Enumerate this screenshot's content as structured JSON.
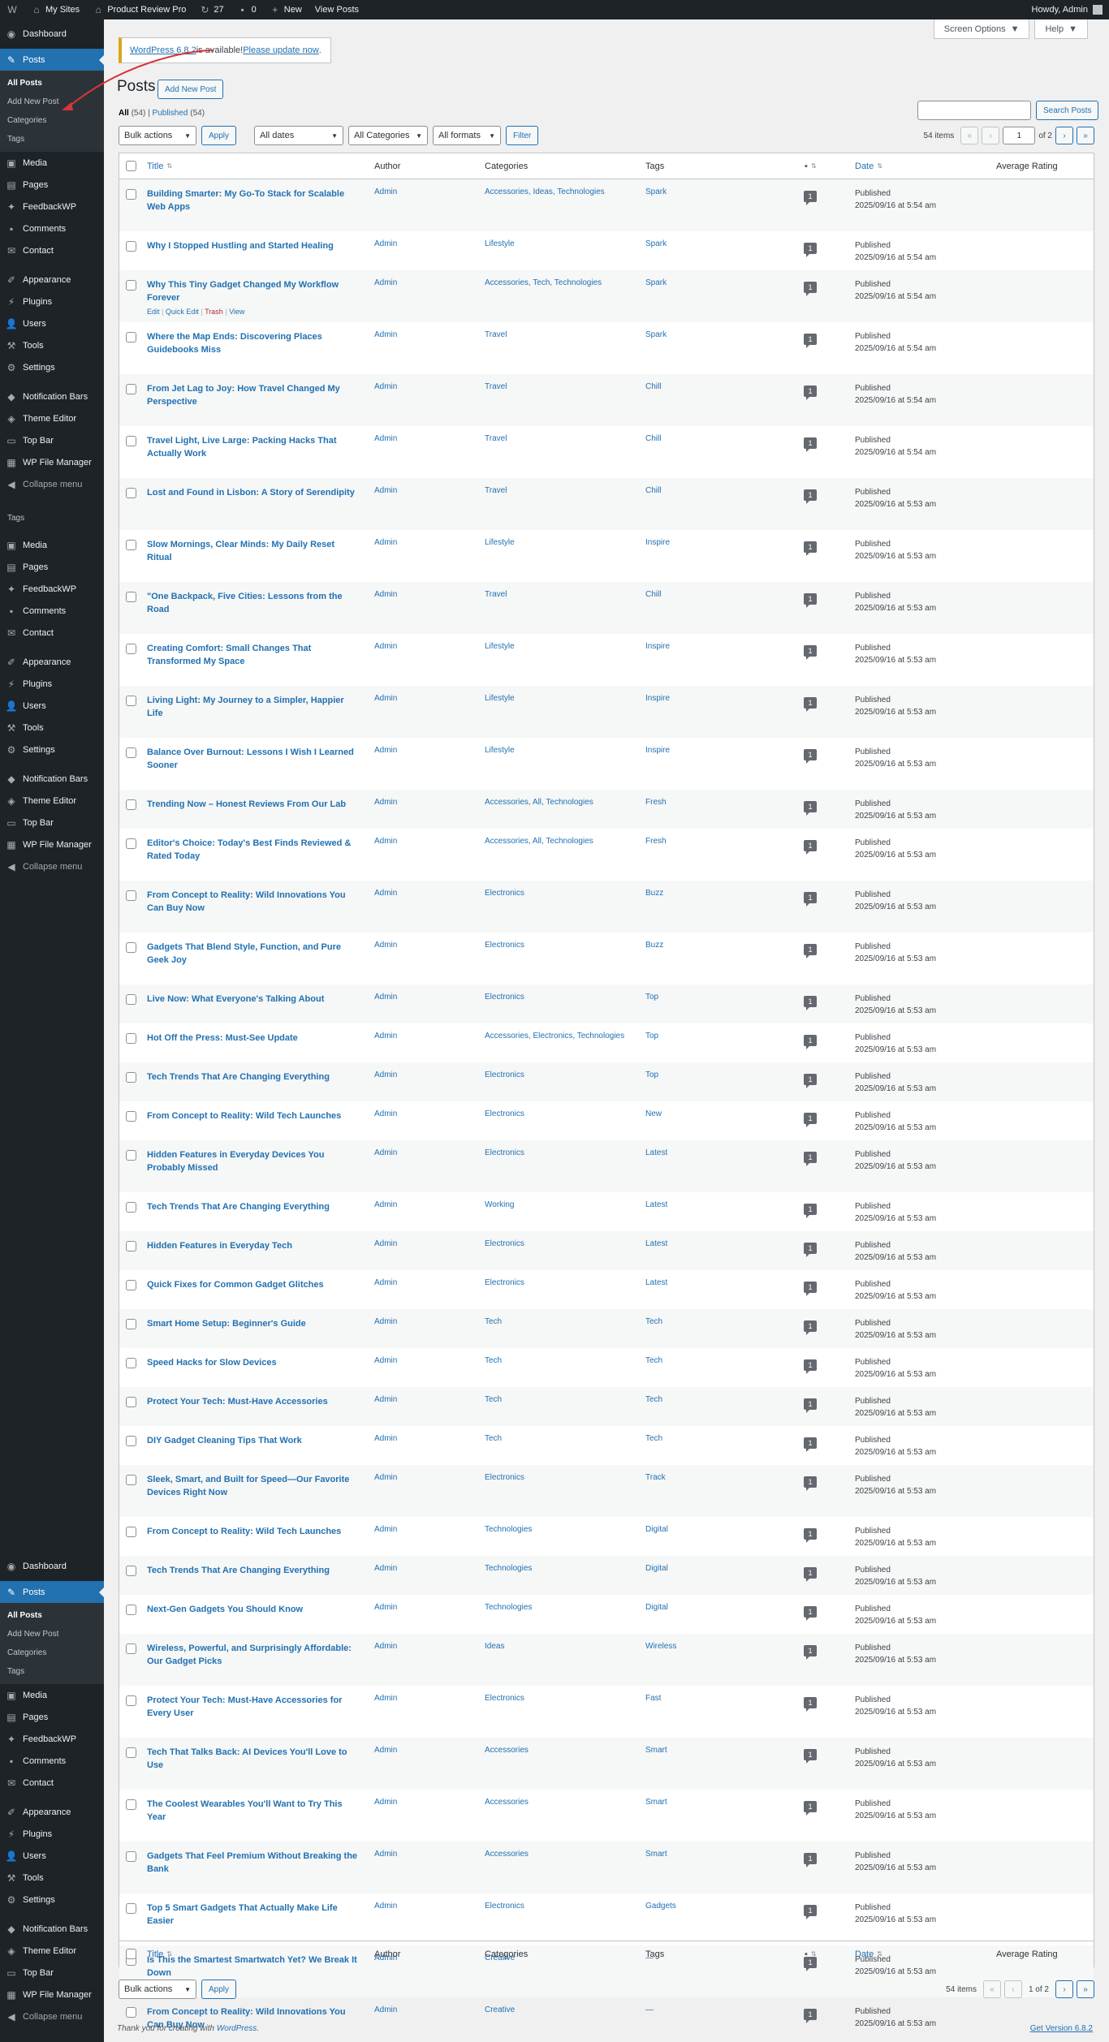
{
  "adminbar": {
    "wp_logo": "W",
    "my_sites": "My Sites",
    "site_name": "Product Review Pro",
    "updates": "27",
    "comments": "0",
    "new": "New",
    "view_posts": "View Posts",
    "howdy": "Howdy, Admin"
  },
  "sidebar": {
    "dashboard": "Dashboard",
    "posts": "Posts",
    "posts_sub": [
      "All Posts",
      "Add New Post",
      "Categories",
      "Tags"
    ],
    "items_a": [
      "Media",
      "Pages",
      "FeedbackWP",
      "Comments",
      "Contact"
    ],
    "items_b": [
      "Appearance",
      "Plugins",
      "Users",
      "Tools",
      "Settings"
    ],
    "items_c": [
      "Notification Bars",
      "Theme Editor",
      "Top Bar",
      "WP File Manager"
    ],
    "collapse": "Collapse menu",
    "overlap_sub": "Tags"
  },
  "screen_options": "Screen Options",
  "help": "Help",
  "notice": {
    "link": "WordPress 6.8.2",
    "text": " is available! ",
    "link2": "Please update now",
    "end": "."
  },
  "page": {
    "title": "Posts",
    "add_new": "Add New Post"
  },
  "subsubsub": {
    "all": "All",
    "all_count": "(54)",
    "sep": "|",
    "published": "Published",
    "published_count": "(54)"
  },
  "search": {
    "button": "Search Posts"
  },
  "filters": {
    "bulk": "Bulk actions",
    "apply": "Apply",
    "dates": "All dates",
    "categories": "All Categories",
    "formats": "All formats",
    "filter": "Filter"
  },
  "pagination": {
    "items": "54 items",
    "first": "«",
    "prev": "‹",
    "current": "1",
    "of": "of 2",
    "next": "›",
    "last": "»",
    "bottom_page": "1 of 2"
  },
  "columns": {
    "title": "Title",
    "author": "Author",
    "categories": "Categories",
    "tags": "Tags",
    "date": "Date",
    "rating": "Average Rating"
  },
  "row_actions": {
    "edit": "Edit",
    "quick_edit": "Quick Edit",
    "trash": "Trash",
    "view": "View"
  },
  "rows": [
    {
      "title": "Building Smarter: My Go-To Stack for Scalable Web Apps",
      "author": "Admin",
      "cats": "Accessories, Ideas, Technologies",
      "tags": "Spark",
      "comments": "1",
      "status": "Published",
      "date": "2025/09/16 at 5:54 am"
    },
    {
      "title": "Why I Stopped Hustling and Started Healing",
      "author": "Admin",
      "cats": "Lifestyle",
      "tags": "Spark",
      "comments": "1",
      "status": "Published",
      "date": "2025/09/16 at 5:54 am"
    },
    {
      "title": "Why This Tiny Gadget Changed My Workflow Forever",
      "author": "Admin",
      "cats": "Accessories, Tech, Technologies",
      "tags": "Spark",
      "comments": "1",
      "status": "Published",
      "date": "2025/09/16 at 5:54 am"
    },
    {
      "title": "Where the Map Ends: Discovering Places Guidebooks Miss",
      "author": "Admin",
      "cats": "Travel",
      "tags": "Spark",
      "comments": "1",
      "status": "Published",
      "date": "2025/09/16 at 5:54 am"
    },
    {
      "title": "From Jet Lag to Joy: How Travel Changed My Perspective",
      "author": "Admin",
      "cats": "Travel",
      "tags": "Chill",
      "comments": "1",
      "status": "Published",
      "date": "2025/09/16 at 5:54 am"
    },
    {
      "title": "Travel Light, Live Large: Packing Hacks That Actually Work",
      "author": "Admin",
      "cats": "Travel",
      "tags": "Chill",
      "comments": "1",
      "status": "Published",
      "date": "2025/09/16 at 5:54 am"
    },
    {
      "title": "Lost and Found in Lisbon: A Story of Serendipity",
      "author": "Admin",
      "cats": "Travel",
      "tags": "Chill",
      "comments": "1",
      "status": "Published",
      "date": "2025/09/16 at 5:53 am"
    },
    {
      "title": "Slow Mornings, Clear Minds: My Daily Reset Ritual",
      "author": "Admin",
      "cats": "Lifestyle",
      "tags": "Inspire",
      "comments": "1",
      "status": "Published",
      "date": "2025/09/16 at 5:53 am"
    },
    {
      "title": "\"One Backpack, Five Cities: Lessons from the Road",
      "author": "Admin",
      "cats": "Travel",
      "tags": "Chill",
      "comments": "1",
      "status": "Published",
      "date": "2025/09/16 at 5:53 am"
    },
    {
      "title": "Creating Comfort: Small Changes That Transformed My Space",
      "author": "Admin",
      "cats": "Lifestyle",
      "tags": "Inspire",
      "comments": "1",
      "status": "Published",
      "date": "2025/09/16 at 5:53 am"
    },
    {
      "title": "Living Light: My Journey to a Simpler, Happier Life",
      "author": "Admin",
      "cats": "Lifestyle",
      "tags": "Inspire",
      "comments": "1",
      "status": "Published",
      "date": "2025/09/16 at 5:53 am"
    },
    {
      "title": "Balance Over Burnout: Lessons I Wish I Learned Sooner",
      "author": "Admin",
      "cats": "Lifestyle",
      "tags": "Inspire",
      "comments": "1",
      "status": "Published",
      "date": "2025/09/16 at 5:53 am"
    },
    {
      "title": "Trending Now – Honest Reviews From Our Lab",
      "author": "Admin",
      "cats": "Accessories, All, Technologies",
      "tags": "Fresh",
      "comments": "1",
      "status": "Published",
      "date": "2025/09/16 at 5:53 am"
    },
    {
      "title": "Editor's Choice: Today's Best Finds Reviewed & Rated Today",
      "author": "Admin",
      "cats": "Accessories, All, Technologies",
      "tags": "Fresh",
      "comments": "1",
      "status": "Published",
      "date": "2025/09/16 at 5:53 am"
    },
    {
      "title": "From Concept to Reality: Wild Innovations You Can Buy Now",
      "author": "Admin",
      "cats": "Electronics",
      "tags": "Buzz",
      "comments": "1",
      "status": "Published",
      "date": "2025/09/16 at 5:53 am"
    },
    {
      "title": "Gadgets That Blend Style, Function, and Pure Geek Joy",
      "author": "Admin",
      "cats": "Electronics",
      "tags": "Buzz",
      "comments": "1",
      "status": "Published",
      "date": "2025/09/16 at 5:53 am"
    },
    {
      "title": "Live Now: What Everyone's Talking About",
      "author": "Admin",
      "cats": "Electronics",
      "tags": "Top",
      "comments": "1",
      "status": "Published",
      "date": "2025/09/16 at 5:53 am"
    },
    {
      "title": "Hot Off the Press: Must-See Update",
      "author": "Admin",
      "cats": "Accessories, Electronics, Technologies",
      "tags": "Top",
      "comments": "1",
      "status": "Published",
      "date": "2025/09/16 at 5:53 am"
    },
    {
      "title": "Tech Trends That Are Changing Everything",
      "author": "Admin",
      "cats": "Electronics",
      "tags": "Top",
      "comments": "1",
      "status": "Published",
      "date": "2025/09/16 at 5:53 am"
    },
    {
      "title": "From Concept to Reality: Wild Tech Launches",
      "author": "Admin",
      "cats": "Electronics",
      "tags": "New",
      "comments": "1",
      "status": "Published",
      "date": "2025/09/16 at 5:53 am"
    },
    {
      "title": "Hidden Features in Everyday Devices You Probably Missed",
      "author": "Admin",
      "cats": "Electronics",
      "tags": "Latest",
      "comments": "1",
      "status": "Published",
      "date": "2025/09/16 at 5:53 am"
    },
    {
      "title": "Tech Trends That Are Changing Everything",
      "author": "Admin",
      "cats": "Working",
      "tags": "Latest",
      "comments": "1",
      "status": "Published",
      "date": "2025/09/16 at 5:53 am"
    },
    {
      "title": "Hidden Features in Everyday Tech",
      "author": "Admin",
      "cats": "Electronics",
      "tags": "Latest",
      "comments": "1",
      "status": "Published",
      "date": "2025/09/16 at 5:53 am"
    },
    {
      "title": "Quick Fixes for Common Gadget Glitches",
      "author": "Admin",
      "cats": "Electronics",
      "tags": "Latest",
      "comments": "1",
      "status": "Published",
      "date": "2025/09/16 at 5:53 am"
    },
    {
      "title": "Smart Home Setup: Beginner's Guide",
      "author": "Admin",
      "cats": "Tech",
      "tags": "Tech",
      "comments": "1",
      "status": "Published",
      "date": "2025/09/16 at 5:53 am"
    },
    {
      "title": "Speed Hacks for Slow Devices",
      "author": "Admin",
      "cats": "Tech",
      "tags": "Tech",
      "comments": "1",
      "status": "Published",
      "date": "2025/09/16 at 5:53 am"
    },
    {
      "title": "Protect Your Tech: Must-Have Accessories",
      "author": "Admin",
      "cats": "Tech",
      "tags": "Tech",
      "comments": "1",
      "status": "Published",
      "date": "2025/09/16 at 5:53 am"
    },
    {
      "title": "DIY Gadget Cleaning Tips That Work",
      "author": "Admin",
      "cats": "Tech",
      "tags": "Tech",
      "comments": "1",
      "status": "Published",
      "date": "2025/09/16 at 5:53 am"
    },
    {
      "title": "Sleek, Smart, and Built for Speed—Our Favorite Devices Right Now",
      "author": "Admin",
      "cats": "Electronics",
      "tags": "Track",
      "comments": "1",
      "status": "Published",
      "date": "2025/09/16 at 5:53 am"
    },
    {
      "title": "From Concept to Reality: Wild Tech Launches",
      "author": "Admin",
      "cats": "Technologies",
      "tags": "Digital",
      "comments": "1",
      "status": "Published",
      "date": "2025/09/16 at 5:53 am"
    },
    {
      "title": "Tech Trends That Are Changing Everything",
      "author": "Admin",
      "cats": "Technologies",
      "tags": "Digital",
      "comments": "1",
      "status": "Published",
      "date": "2025/09/16 at 5:53 am"
    },
    {
      "title": "Next-Gen Gadgets You Should Know",
      "author": "Admin",
      "cats": "Technologies",
      "tags": "Digital",
      "comments": "1",
      "status": "Published",
      "date": "2025/09/16 at 5:53 am"
    },
    {
      "title": "Wireless, Powerful, and Surprisingly Affordable: Our Gadget Picks",
      "author": "Admin",
      "cats": "Ideas",
      "tags": "Wireless",
      "comments": "1",
      "status": "Published",
      "date": "2025/09/16 at 5:53 am"
    },
    {
      "title": "Protect Your Tech: Must-Have Accessories for Every User",
      "author": "Admin",
      "cats": "Electronics",
      "tags": "Fast",
      "comments": "1",
      "status": "Published",
      "date": "2025/09/16 at 5:53 am"
    },
    {
      "title": "Tech That Talks Back: AI Devices You'll Love to Use",
      "author": "Admin",
      "cats": "Accessories",
      "tags": "Smart",
      "comments": "1",
      "status": "Published",
      "date": "2025/09/16 at 5:53 am"
    },
    {
      "title": "The Coolest Wearables You'll Want to Try This Year",
      "author": "Admin",
      "cats": "Accessories",
      "tags": "Smart",
      "comments": "1",
      "status": "Published",
      "date": "2025/09/16 at 5:53 am"
    },
    {
      "title": "Gadgets That Feel Premium Without Breaking the Bank",
      "author": "Admin",
      "cats": "Accessories",
      "tags": "Smart",
      "comments": "1",
      "status": "Published",
      "date": "2025/09/16 at 5:53 am"
    },
    {
      "title": "Top 5 Smart Gadgets That Actually Make Life Easier",
      "author": "Admin",
      "cats": "Electronics",
      "tags": "Gadgets",
      "comments": "1",
      "status": "Published",
      "date": "2025/09/16 at 5:53 am"
    },
    {
      "title": "Is This the Smartest Smartwatch Yet? We Break It Down",
      "author": "Admin",
      "cats": "Creative",
      "tags": "—",
      "comments": "1",
      "status": "Published",
      "date": "2025/09/16 at 5:53 am"
    },
    {
      "title": "From Concept to Reality: Wild Innovations You Can Buy Now",
      "author": "Admin",
      "cats": "Creative",
      "tags": "—",
      "comments": "1",
      "status": "Published",
      "date": "2025/09/16 at 5:53 am"
    }
  ],
  "footer": {
    "thanks": "Thank you for creating with ",
    "wp": "WordPress",
    "dot": ".",
    "version": "Get Version 6.8.2"
  },
  "colors": {
    "accent": "#2271b1",
    "sidebar": "#1d2327",
    "pointer": "#d63638"
  }
}
